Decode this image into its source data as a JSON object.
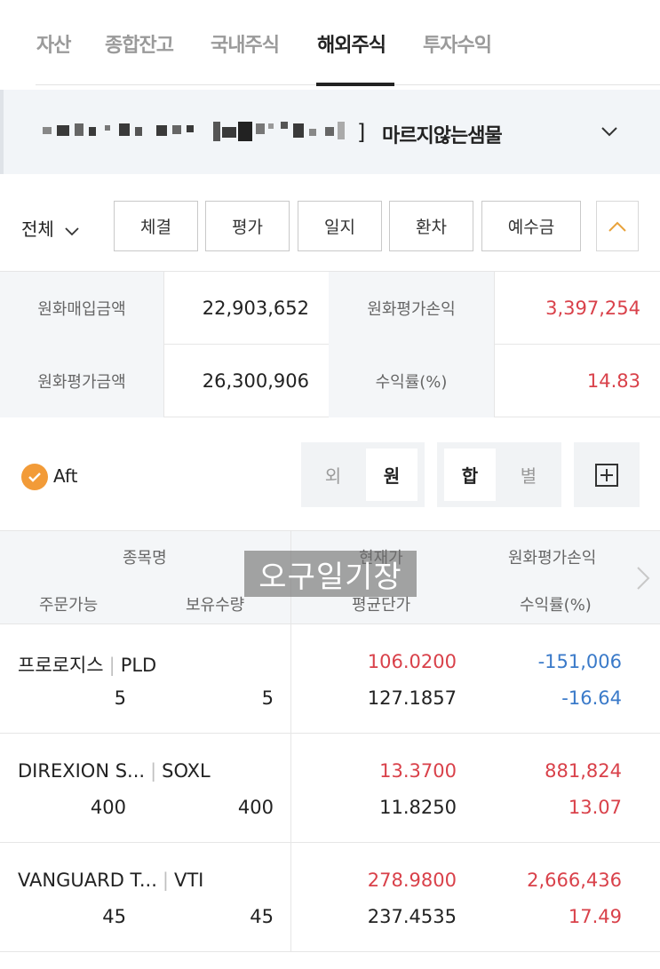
{
  "tabs": [
    {
      "label": "자산",
      "active": false
    },
    {
      "label": "종합잔고",
      "active": false
    },
    {
      "label": "국내주식",
      "active": false
    },
    {
      "label": "해외주식",
      "active": true
    },
    {
      "label": "투자수익",
      "active": false
    }
  ],
  "account": {
    "bracket": "]",
    "name": "마르지않는샘물"
  },
  "filter": {
    "scope": "전체",
    "buttons": [
      "체결",
      "평가",
      "일지",
      "환차",
      "예수금"
    ]
  },
  "summary": {
    "purchase_label": "원화매입금액",
    "purchase_value": "22,903,652",
    "pnl_label": "원화평가손익",
    "pnl_value": "3,397,254",
    "eval_label": "원화평가금액",
    "eval_value": "26,300,906",
    "rate_label": "수익률(%)",
    "rate_value": "14.83"
  },
  "options": {
    "aft_label": "Aft",
    "currency": {
      "foreign": "외",
      "won": "원",
      "selected": "원"
    },
    "view": {
      "sum": "합",
      "each": "별",
      "selected": "합"
    }
  },
  "table": {
    "headers": {
      "name": "종목명",
      "orderable": "주문가능",
      "holding": "보유수량",
      "current_price": "현재가",
      "avg_price": "평균단가",
      "won_pnl": "원화평가손익",
      "rate": "수익률(%)"
    },
    "watermark": "오구일기장",
    "rows": [
      {
        "name": "프로로지스",
        "ticker": "PLD",
        "orderable": "5",
        "holding": "5",
        "current_price": "106.0200",
        "avg_price": "127.1857",
        "pnl": "-151,006",
        "rate": "-16.64",
        "dir": "down"
      },
      {
        "name": "DIREXION S...",
        "ticker": "SOXL",
        "orderable": "400",
        "holding": "400",
        "current_price": "13.3700",
        "avg_price": "11.8250",
        "pnl": "881,824",
        "rate": "13.07",
        "dir": "up"
      },
      {
        "name": "VANGUARD T...",
        "ticker": "VTI",
        "orderable": "45",
        "holding": "45",
        "current_price": "278.9800",
        "avg_price": "237.4535",
        "pnl": "2,666,436",
        "rate": "17.49",
        "dir": "up"
      }
    ]
  },
  "colors": {
    "up": "#d9414a",
    "down": "#3a7ac9",
    "accent": "#f29b38"
  }
}
